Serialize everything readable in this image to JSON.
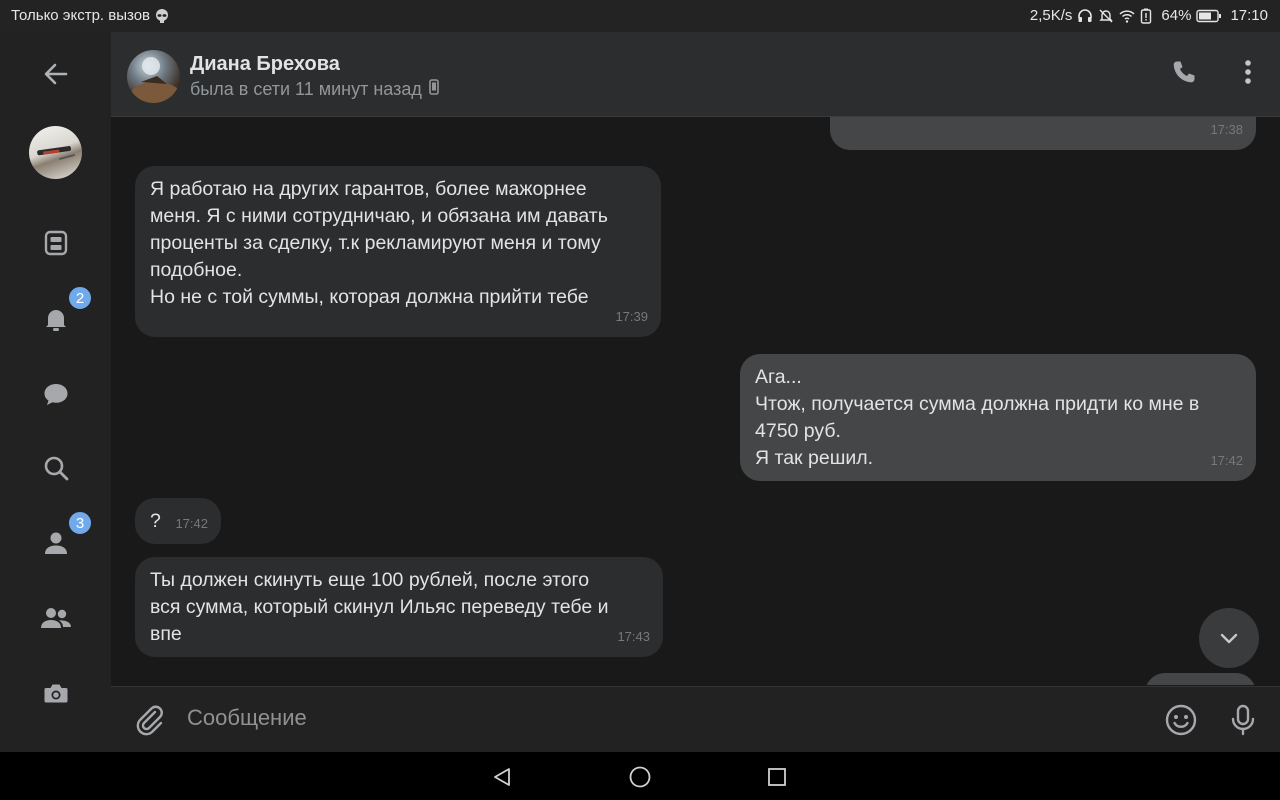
{
  "status_bar": {
    "carrier": "Только экстр. вызов",
    "speed": "2,5K/s",
    "battery": "64%",
    "time": "17:10"
  },
  "rail": {
    "items": [
      {
        "name": "back-icon"
      },
      {
        "name": "newsfeed-icon"
      },
      {
        "name": "notifications-icon",
        "badge": "2"
      },
      {
        "name": "messages-icon"
      },
      {
        "name": "search-icon"
      },
      {
        "name": "friends-icon",
        "badge": "3"
      },
      {
        "name": "communities-icon"
      },
      {
        "name": "camera-icon"
      }
    ]
  },
  "header": {
    "name": "Диана Брехова",
    "status": "была в сети 11 минут назад"
  },
  "messages": [
    {
      "dir": "out",
      "text": "",
      "time": "17:38",
      "partial": true
    },
    {
      "dir": "in",
      "text": "Я работаю на других гарантов, более мажорнее\nменя. Я с ними сотрудничаю, и обязана им давать\nпроценты за сделку, т.к рекламируют меня и тому\nподобное.\nНо не с той суммы, которая должна прийти тебе",
      "time": "17:39"
    },
    {
      "dir": "out",
      "text": "Ага...\nЧтож, получается сумма должна придти ко мне в\n4750 руб.\nЯ так решил.",
      "time": "17:42"
    },
    {
      "dir": "in",
      "text": "?",
      "time": "17:42"
    },
    {
      "dir": "in",
      "text": "Ты должен скинуть еще 100 рублей, после этого\nвся сумма, который скинул Ильяс переведу тебе и\nвпе",
      "time": "17:43"
    }
  ],
  "composer": {
    "placeholder": "Сообщение"
  },
  "colors": {
    "accent": "#71aaeb",
    "background": "#19191a",
    "incoming_bubble": "#2c2d2e",
    "outgoing_bubble": "#454647"
  }
}
